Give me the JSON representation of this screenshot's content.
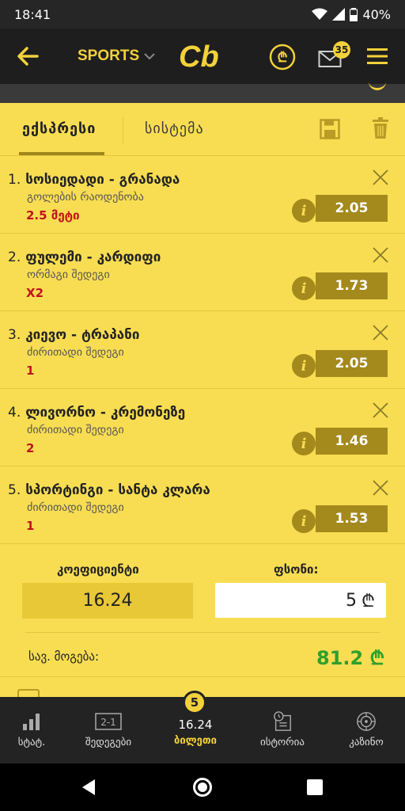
{
  "status_bar": {
    "time": "18:41",
    "battery": "40%"
  },
  "header": {
    "sports_label": "SPORTS",
    "logo_text": "Cb",
    "mail_badge": "35"
  },
  "colors": {
    "accent": "#f2d13b",
    "slip_bg": "#f8dd52",
    "odds_bg": "#a4891c",
    "pick_red": "#c0121d",
    "win_green": "#2ea02b",
    "header_bg": "#1e1e1e"
  },
  "tabs": {
    "express": "ექსპრესი",
    "system": "სისტემა"
  },
  "bets": [
    {
      "num": "1.",
      "title": "სოსიედადი - გრანადა",
      "market": "გოლების რაოდენობა",
      "pick": "2.5 მეტი",
      "odds": "2.05"
    },
    {
      "num": "2.",
      "title": "ფულემი - კარდიფი",
      "market": "ორმაგი შედეგი",
      "pick": "X2",
      "odds": "1.73"
    },
    {
      "num": "3.",
      "title": "კიევო - ტრაპანი",
      "market": "ძირითადი შედეგი",
      "pick": "1",
      "odds": "2.05"
    },
    {
      "num": "4.",
      "title": "ლივორნო - კრემონეზე",
      "market": "ძირითადი შედეგი",
      "pick": "2",
      "odds": "1.46"
    },
    {
      "num": "5.",
      "title": "სპორტინგი - სანტა კლარა",
      "market": "ძირითადი შედეგი",
      "pick": "1",
      "odds": "1.53"
    }
  ],
  "summary": {
    "coef_label": "კოეფიციენტი",
    "coef_value": "16.24",
    "stake_label": "ფსონი:",
    "stake_value": "5",
    "currency": "₾",
    "win_label": "სავ. მოგება:",
    "win_value": "81.2 ₾"
  },
  "bottom_nav": {
    "stats": "სტატ.",
    "results": "შედეგები",
    "ticket_count": "5",
    "ticket_value": "16.24",
    "ticket": "ბილეთი",
    "history": "ისტორია",
    "casino": "კაზინო",
    "results_icon_text": "2-1"
  }
}
